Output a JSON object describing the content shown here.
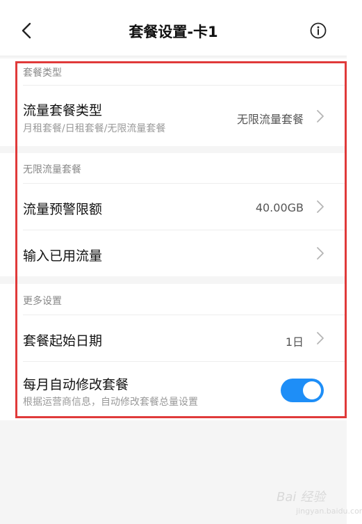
{
  "header": {
    "title": "套餐设置-卡1"
  },
  "sections": [
    {
      "label": "套餐类型",
      "rows": [
        {
          "title": "流量套餐类型",
          "subtitle": "月租套餐/日租套餐/无限流量套餐",
          "value": "无限流量套餐"
        }
      ]
    },
    {
      "label": "无限流量套餐",
      "rows": [
        {
          "title": "流量预警限额",
          "value": "40.00GB"
        },
        {
          "title": "输入已用流量",
          "value": ""
        }
      ]
    },
    {
      "label": "更多设置",
      "rows": [
        {
          "title": "套餐起始日期",
          "value": "1日"
        },
        {
          "title": "每月自动修改套餐",
          "subtitle": "根据运营商信息，自动修改套餐总量设置",
          "toggle_on": true
        }
      ]
    }
  ],
  "colors": {
    "accent": "#1e8ef7",
    "highlight": "#e03a3a"
  },
  "watermark": {
    "text": "Bai 经验",
    "sub": "jingyan.baidu.com"
  }
}
